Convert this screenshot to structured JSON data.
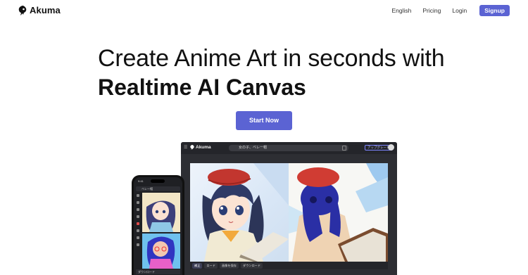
{
  "nav": {
    "brand": "Akuma",
    "links": [
      "English",
      "Pricing",
      "Login"
    ],
    "signup": "Signup"
  },
  "hero": {
    "line1": "Create Anime Art in seconds with",
    "line2": "Realtime AI Canvas",
    "cta": "Start Now"
  },
  "desktop_app": {
    "brand": "Akuma",
    "prompt": "女の子、ベレー帽",
    "upgrade": "アップグレード",
    "tools": [
      "補正",
      "ロード",
      "画像を保存",
      "ダウンロード"
    ]
  },
  "phone_app": {
    "time": "9:41",
    "top_label": "ベレー帽",
    "bottom_label": "ダウンロード"
  },
  "colors": {
    "accent": "#5b63d3",
    "text": "#111111",
    "app_dark": "#2d2e33"
  }
}
